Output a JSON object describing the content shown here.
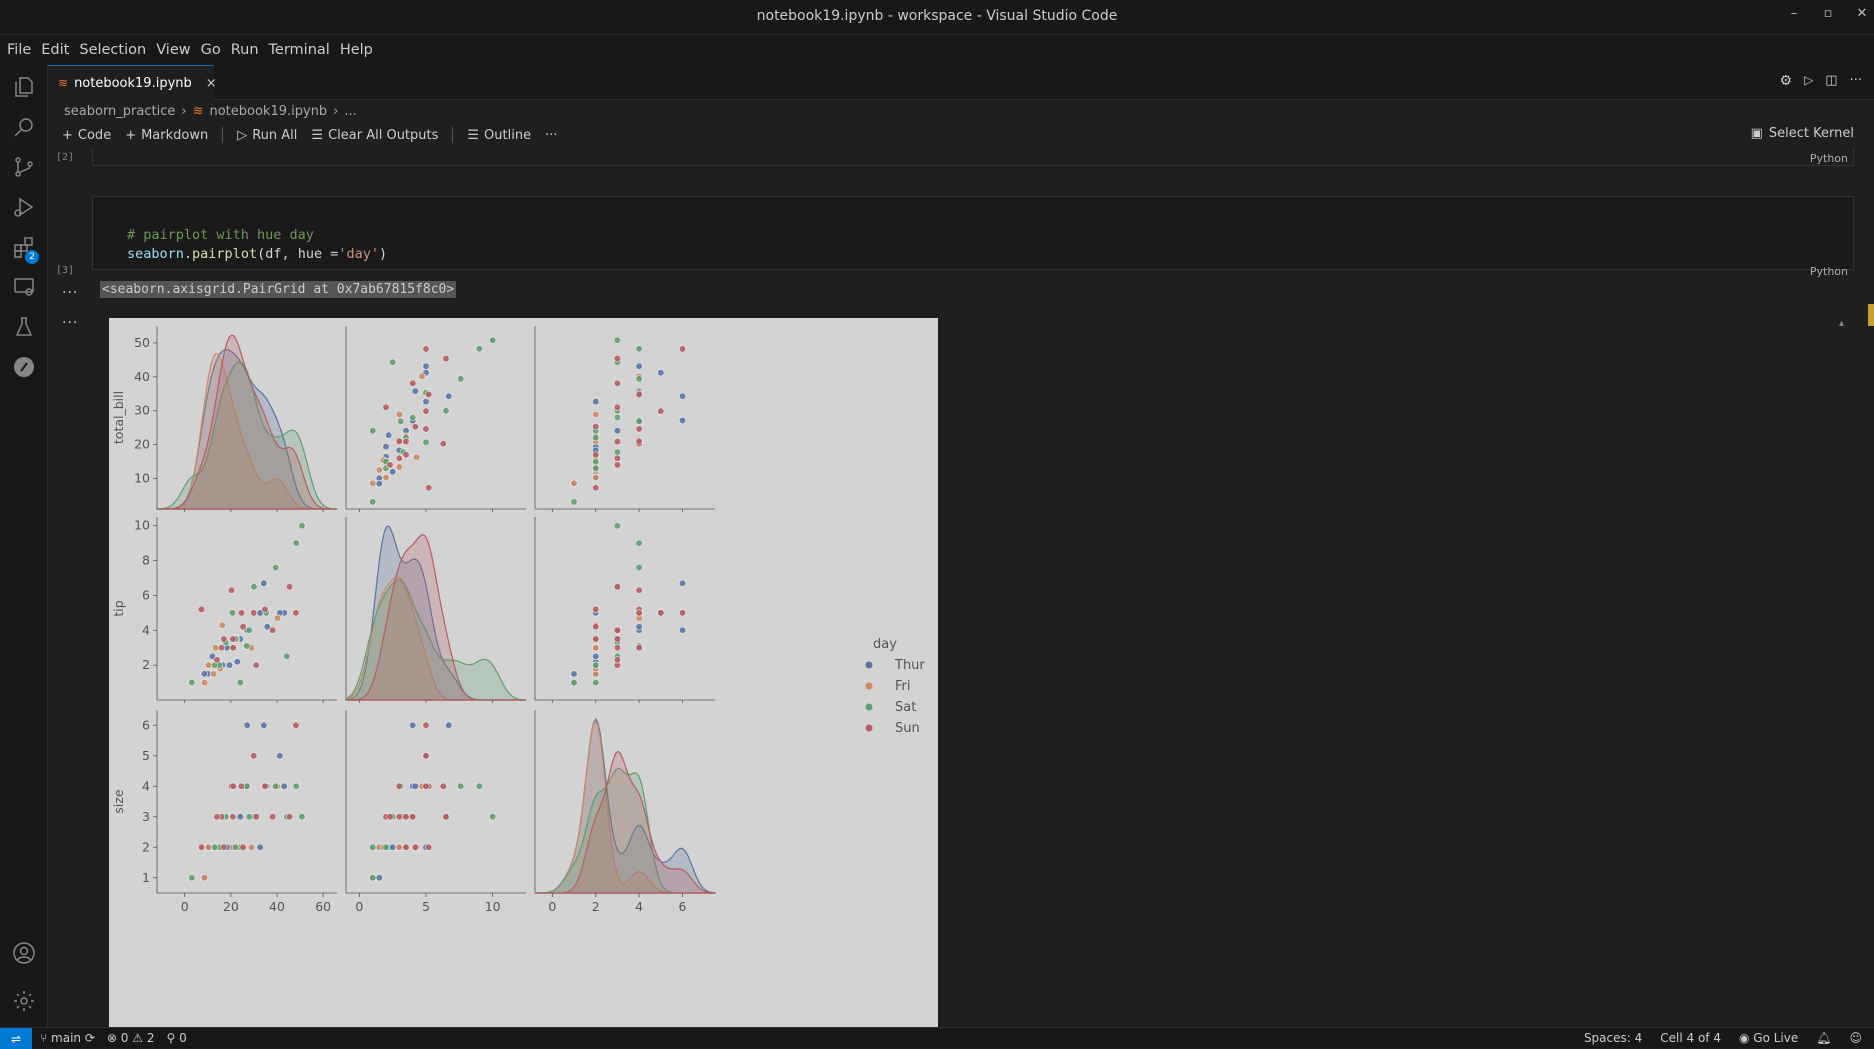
{
  "window": {
    "title": "notebook19.ipynb - workspace - Visual Studio Code"
  },
  "menu": [
    "File",
    "Edit",
    "Selection",
    "View",
    "Go",
    "Run",
    "Terminal",
    "Help"
  ],
  "activity": {
    "extensions_badge": "2"
  },
  "tab": {
    "label": "notebook19.ipynb",
    "close": "×"
  },
  "breadcrumb": {
    "folder": "seaborn_practice",
    "file": "notebook19.ipynb",
    "more": "..."
  },
  "toolbar": {
    "code": "Code",
    "markdown": "Markdown",
    "run_all": "Run All",
    "clear_outputs": "Clear All Outputs",
    "outline": "Outline",
    "more": "···",
    "kernel": "Select Kernel"
  },
  "cells": {
    "prev": {
      "exec": "[2]",
      "lang": "Python"
    },
    "current": {
      "exec": "[3]",
      "lang": "Python",
      "line1": "# pairplot with hue day",
      "line2_obj": "seaborn",
      "line2_dot": ".",
      "line2_func": "pairplot",
      "line2_args_a": "(df, hue =",
      "line2_str": "'day'",
      "line2_close": ")"
    },
    "output_text": "<seaborn.axisgrid.PairGrid at 0x7ab67815f8c0>",
    "out_dots": "···"
  },
  "chart_data": {
    "type": "scatter",
    "title": "",
    "variables": [
      "total_bill",
      "tip",
      "size"
    ],
    "hue": "day",
    "legend": {
      "title": "day",
      "placement": "right",
      "entries": [
        "Thur",
        "Fri",
        "Sat",
        "Sun"
      ]
    },
    "colors": {
      "Thur": "#5875a4",
      "Fri": "#cc8963",
      "Sat": "#5f9e6e",
      "Sun": "#b55d60"
    },
    "xticks": {
      "total_bill": [
        "0",
        "20",
        "40",
        "60"
      ],
      "tip": [
        "0",
        "5",
        "10"
      ],
      "size": [
        "0",
        "2",
        "4",
        "6"
      ]
    },
    "yticks": {
      "total_bill": [
        "10",
        "20",
        "30",
        "40",
        "50"
      ],
      "tip": [
        "2",
        "4",
        "6",
        "8",
        "10"
      ],
      "size": [
        "1",
        "2",
        "3",
        "4",
        "5",
        "6"
      ]
    },
    "xlim": {
      "total_bill": [
        -12,
        66
      ],
      "tip": [
        -1,
        12.5
      ],
      "size": [
        -0.8,
        7.5
      ]
    },
    "ylim": {
      "total_bill": [
        1,
        55
      ],
      "tip": [
        0,
        10.5
      ],
      "size": [
        0.5,
        6.5
      ]
    },
    "points": [
      {
        "day": "Thur",
        "total_bill": 27.2,
        "tip": 4.0,
        "size": 4
      },
      {
        "day": "Thur",
        "total_bill": 22.8,
        "tip": 2.2,
        "size": 2
      },
      {
        "day": "Thur",
        "total_bill": 19.4,
        "tip": 2.0,
        "size": 2
      },
      {
        "day": "Thur",
        "total_bill": 32.7,
        "tip": 5.0,
        "size": 2
      },
      {
        "day": "Thur",
        "total_bill": 16.4,
        "tip": 2.0,
        "size": 2
      },
      {
        "day": "Thur",
        "total_bill": 10.1,
        "tip": 1.5,
        "size": 2
      },
      {
        "day": "Thur",
        "total_bill": 43.1,
        "tip": 5.0,
        "size": 4
      },
      {
        "day": "Thur",
        "total_bill": 34.3,
        "tip": 6.7,
        "size": 6
      },
      {
        "day": "Thur",
        "total_bill": 41.2,
        "tip": 5.0,
        "size": 5
      },
      {
        "day": "Thur",
        "total_bill": 27.1,
        "tip": 4.0,
        "size": 6
      },
      {
        "day": "Thur",
        "total_bill": 8.5,
        "tip": 1.5,
        "size": 1
      },
      {
        "day": "Thur",
        "total_bill": 15.0,
        "tip": 2.0,
        "size": 2
      },
      {
        "day": "Thur",
        "total_bill": 12.0,
        "tip": 2.5,
        "size": 2
      },
      {
        "day": "Thur",
        "total_bill": 18.3,
        "tip": 3.0,
        "size": 2
      },
      {
        "day": "Thur",
        "total_bill": 24.1,
        "tip": 3.5,
        "size": 3
      },
      {
        "day": "Thur",
        "total_bill": 35.8,
        "tip": 4.2,
        "size": 4
      },
      {
        "day": "Fri",
        "total_bill": 28.9,
        "tip": 3.0,
        "size": 2
      },
      {
        "day": "Fri",
        "total_bill": 22.5,
        "tip": 3.5,
        "size": 2
      },
      {
        "day": "Fri",
        "total_bill": 12.5,
        "tip": 1.5,
        "size": 2
      },
      {
        "day": "Fri",
        "total_bill": 15.4,
        "tip": 1.8,
        "size": 2
      },
      {
        "day": "Fri",
        "total_bill": 13.4,
        "tip": 3.0,
        "size": 2
      },
      {
        "day": "Fri",
        "total_bill": 40.2,
        "tip": 4.7,
        "size": 4
      },
      {
        "day": "Fri",
        "total_bill": 8.6,
        "tip": 1.0,
        "size": 1
      },
      {
        "day": "Fri",
        "total_bill": 16.3,
        "tip": 4.3,
        "size": 2
      },
      {
        "day": "Fri",
        "total_bill": 21.0,
        "tip": 3.0,
        "size": 2
      },
      {
        "day": "Fri",
        "total_bill": 10.3,
        "tip": 2.0,
        "size": 2
      },
      {
        "day": "Sat",
        "total_bill": 50.8,
        "tip": 10.0,
        "size": 3
      },
      {
        "day": "Sat",
        "total_bill": 48.3,
        "tip": 9.0,
        "size": 4
      },
      {
        "day": "Sat",
        "total_bill": 39.4,
        "tip": 7.6,
        "size": 4
      },
      {
        "day": "Sat",
        "total_bill": 20.7,
        "tip": 5.0,
        "size": 4
      },
      {
        "day": "Sat",
        "total_bill": 3.1,
        "tip": 1.0,
        "size": 1
      },
      {
        "day": "Sat",
        "total_bill": 26.9,
        "tip": 3.1,
        "size": 4
      },
      {
        "day": "Sat",
        "total_bill": 44.3,
        "tip": 2.5,
        "size": 3
      },
      {
        "day": "Sat",
        "total_bill": 24.1,
        "tip": 1.0,
        "size": 2
      },
      {
        "day": "Sat",
        "total_bill": 15.0,
        "tip": 2.0,
        "size": 2
      },
      {
        "day": "Sat",
        "total_bill": 30.0,
        "tip": 6.5,
        "size": 3
      },
      {
        "day": "Sat",
        "total_bill": 17.8,
        "tip": 3.3,
        "size": 3
      },
      {
        "day": "Sat",
        "total_bill": 22.0,
        "tip": 3.5,
        "size": 2
      },
      {
        "day": "Sat",
        "total_bill": 35.3,
        "tip": 5.0,
        "size": 4
      },
      {
        "day": "Sat",
        "total_bill": 13.0,
        "tip": 2.0,
        "size": 2
      },
      {
        "day": "Sat",
        "total_bill": 28.0,
        "tip": 4.0,
        "size": 3
      },
      {
        "day": "Sun",
        "total_bill": 48.2,
        "tip": 5.0,
        "size": 6
      },
      {
        "day": "Sun",
        "total_bill": 45.4,
        "tip": 6.5,
        "size": 3
      },
      {
        "day": "Sun",
        "total_bill": 34.8,
        "tip": 5.2,
        "size": 4
      },
      {
        "day": "Sun",
        "total_bill": 7.3,
        "tip": 5.2,
        "size": 2
      },
      {
        "day": "Sun",
        "total_bill": 17.0,
        "tip": 3.5,
        "size": 2
      },
      {
        "day": "Sun",
        "total_bill": 38.1,
        "tip": 4.0,
        "size": 3
      },
      {
        "day": "Sun",
        "total_bill": 24.6,
        "tip": 5.0,
        "size": 4
      },
      {
        "day": "Sun",
        "total_bill": 20.3,
        "tip": 6.3,
        "size": 4
      },
      {
        "day": "Sun",
        "total_bill": 25.3,
        "tip": 4.2,
        "size": 2
      },
      {
        "day": "Sun",
        "total_bill": 16.0,
        "tip": 3.0,
        "size": 3
      },
      {
        "day": "Sun",
        "total_bill": 20.9,
        "tip": 3.5,
        "size": 3
      },
      {
        "day": "Sun",
        "total_bill": 31.0,
        "tip": 2.0,
        "size": 3
      },
      {
        "day": "Sun",
        "total_bill": 21.0,
        "tip": 3.0,
        "size": 4
      },
      {
        "day": "Sun",
        "total_bill": 29.9,
        "tip": 5.0,
        "size": 5
      },
      {
        "day": "Sun",
        "total_bill": 14.0,
        "tip": 2.3,
        "size": 3
      }
    ]
  },
  "status": {
    "branch": "main",
    "errors": "0",
    "warnings": "2",
    "ports": "0",
    "spaces": "Spaces: 4",
    "cell": "Cell 4 of 4",
    "golive": "Go Live"
  }
}
